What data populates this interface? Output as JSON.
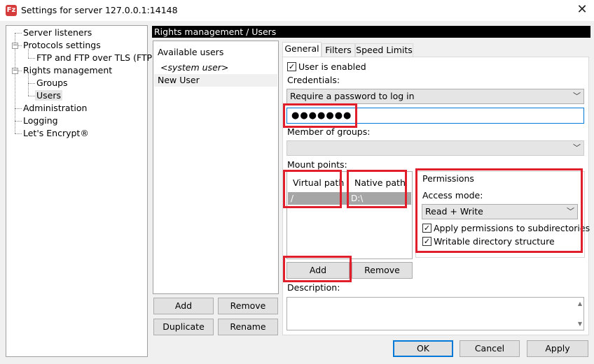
{
  "window": {
    "title": "Settings for server 127.0.0.1:14148",
    "icon_label": "Fz",
    "close_glyph": "✕"
  },
  "tree": {
    "items": [
      {
        "label": "Server listeners"
      },
      {
        "label": "Protocols settings",
        "expander": "−"
      },
      {
        "label": "FTP and FTP over TLS (FTPS)"
      },
      {
        "label": "Rights management",
        "expander": "−"
      },
      {
        "label": "Groups"
      },
      {
        "label": "Users"
      },
      {
        "label": "Administration"
      },
      {
        "label": "Logging"
      },
      {
        "label": "Let's Encrypt®"
      }
    ]
  },
  "header": {
    "title": "Rights management / Users"
  },
  "users": {
    "heading": "Available users",
    "items": [
      "<system user>",
      "New User"
    ],
    "buttons": {
      "add": "Add",
      "remove": "Remove",
      "duplicate": "Duplicate",
      "rename": "Rename"
    }
  },
  "tabs": [
    "General",
    "Filters",
    "Speed Limits"
  ],
  "general": {
    "user_enabled_label": "User is enabled",
    "user_enabled_checked": true,
    "credentials_label": "Credentials:",
    "credentials_value": "Require a password to log in",
    "password_value": "●●●●●●●",
    "member_of_groups_label": "Member of groups:",
    "member_of_groups_value": "",
    "mount_points_label": "Mount points:",
    "mount_columns": [
      "Virtual path",
      "Native path"
    ],
    "mount_rows": [
      {
        "virtual": "/",
        "native": "D:\\"
      }
    ],
    "mount_add": "Add",
    "mount_remove": "Remove",
    "description_label": "Description:",
    "description_value": ""
  },
  "permissions": {
    "group_label": "Permissions",
    "access_mode_label": "Access mode:",
    "access_mode_value": "Read + Write",
    "apply_subdirs_label": "Apply permissions to subdirectories",
    "writable_structure_label": "Writable directory structure",
    "apply_subdirs_checked": true,
    "writable_structure_checked": true
  },
  "dialog_buttons": {
    "ok": "OK",
    "cancel": "Cancel",
    "apply": "Apply"
  },
  "icons": {
    "chevron_down": "﹀",
    "check": "✓",
    "scroll_up": "▲",
    "scroll_down": "▼"
  },
  "colors": {
    "highlight_red": "#e01e2c",
    "focus_blue": "#0078d7",
    "header_black": "#000000"
  }
}
